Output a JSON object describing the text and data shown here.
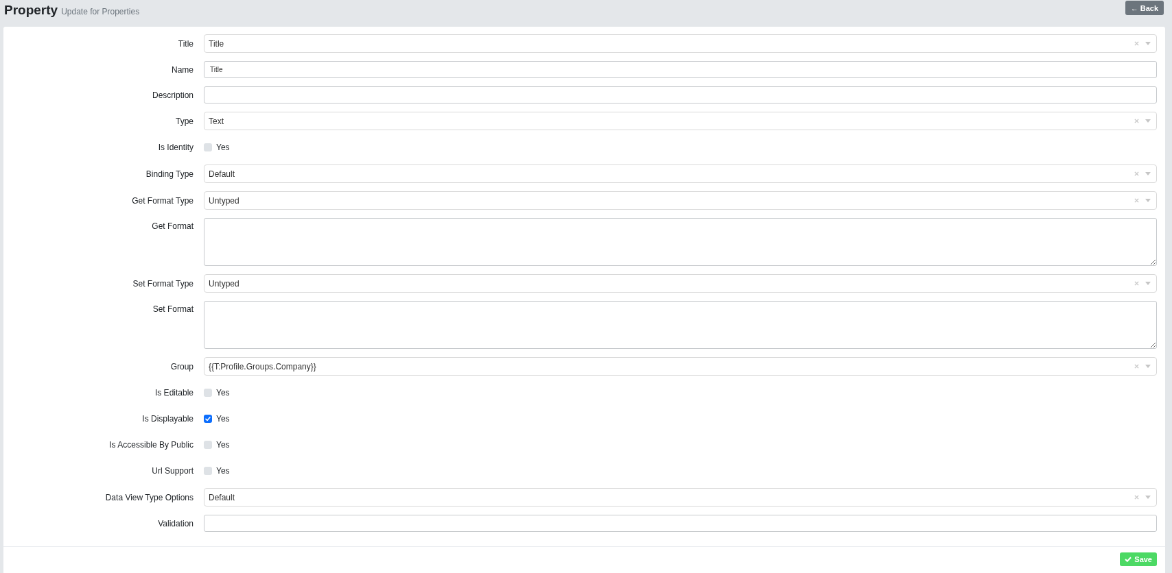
{
  "header": {
    "title": "Property",
    "subtitle": "Update for Properties",
    "back_button": "← Back"
  },
  "fields": [
    {
      "kind": "select",
      "label": "Title",
      "value": "Title"
    },
    {
      "kind": "input",
      "label": "Name",
      "value": "Title"
    },
    {
      "kind": "input",
      "label": "Description"
    },
    {
      "kind": "select",
      "label": "Type",
      "value": "Text"
    },
    {
      "kind": "checkbox",
      "label": "Is Identity",
      "option": "Yes",
      "checked": false
    },
    {
      "kind": "select",
      "label": "Binding Type",
      "value": "Default"
    },
    {
      "kind": "select",
      "label": "Get Format Type",
      "value": "Untyped"
    },
    {
      "kind": "textarea",
      "label": "Get Format"
    },
    {
      "kind": "select",
      "label": "Set Format Type",
      "value": "Untyped"
    },
    {
      "kind": "textarea",
      "label": "Set Format"
    },
    {
      "kind": "select",
      "label": "Group",
      "value": "{{T:Profile.Groups.Company}}"
    },
    {
      "kind": "checkbox",
      "label": "Is Editable",
      "option": "Yes",
      "checked": false
    },
    {
      "kind": "checkbox",
      "label": "Is Displayable",
      "option": "Yes",
      "checked": true
    },
    {
      "kind": "checkbox",
      "label": "Is Accessible By Public",
      "option": "Yes",
      "checked": false
    },
    {
      "kind": "checkbox",
      "label": "Url Support",
      "option": "Yes",
      "checked": false
    },
    {
      "kind": "select",
      "label": "Data View Type Options",
      "value": "Default"
    },
    {
      "kind": "input",
      "label": "Validation"
    }
  ],
  "footer": {
    "save_button": "Save"
  }
}
